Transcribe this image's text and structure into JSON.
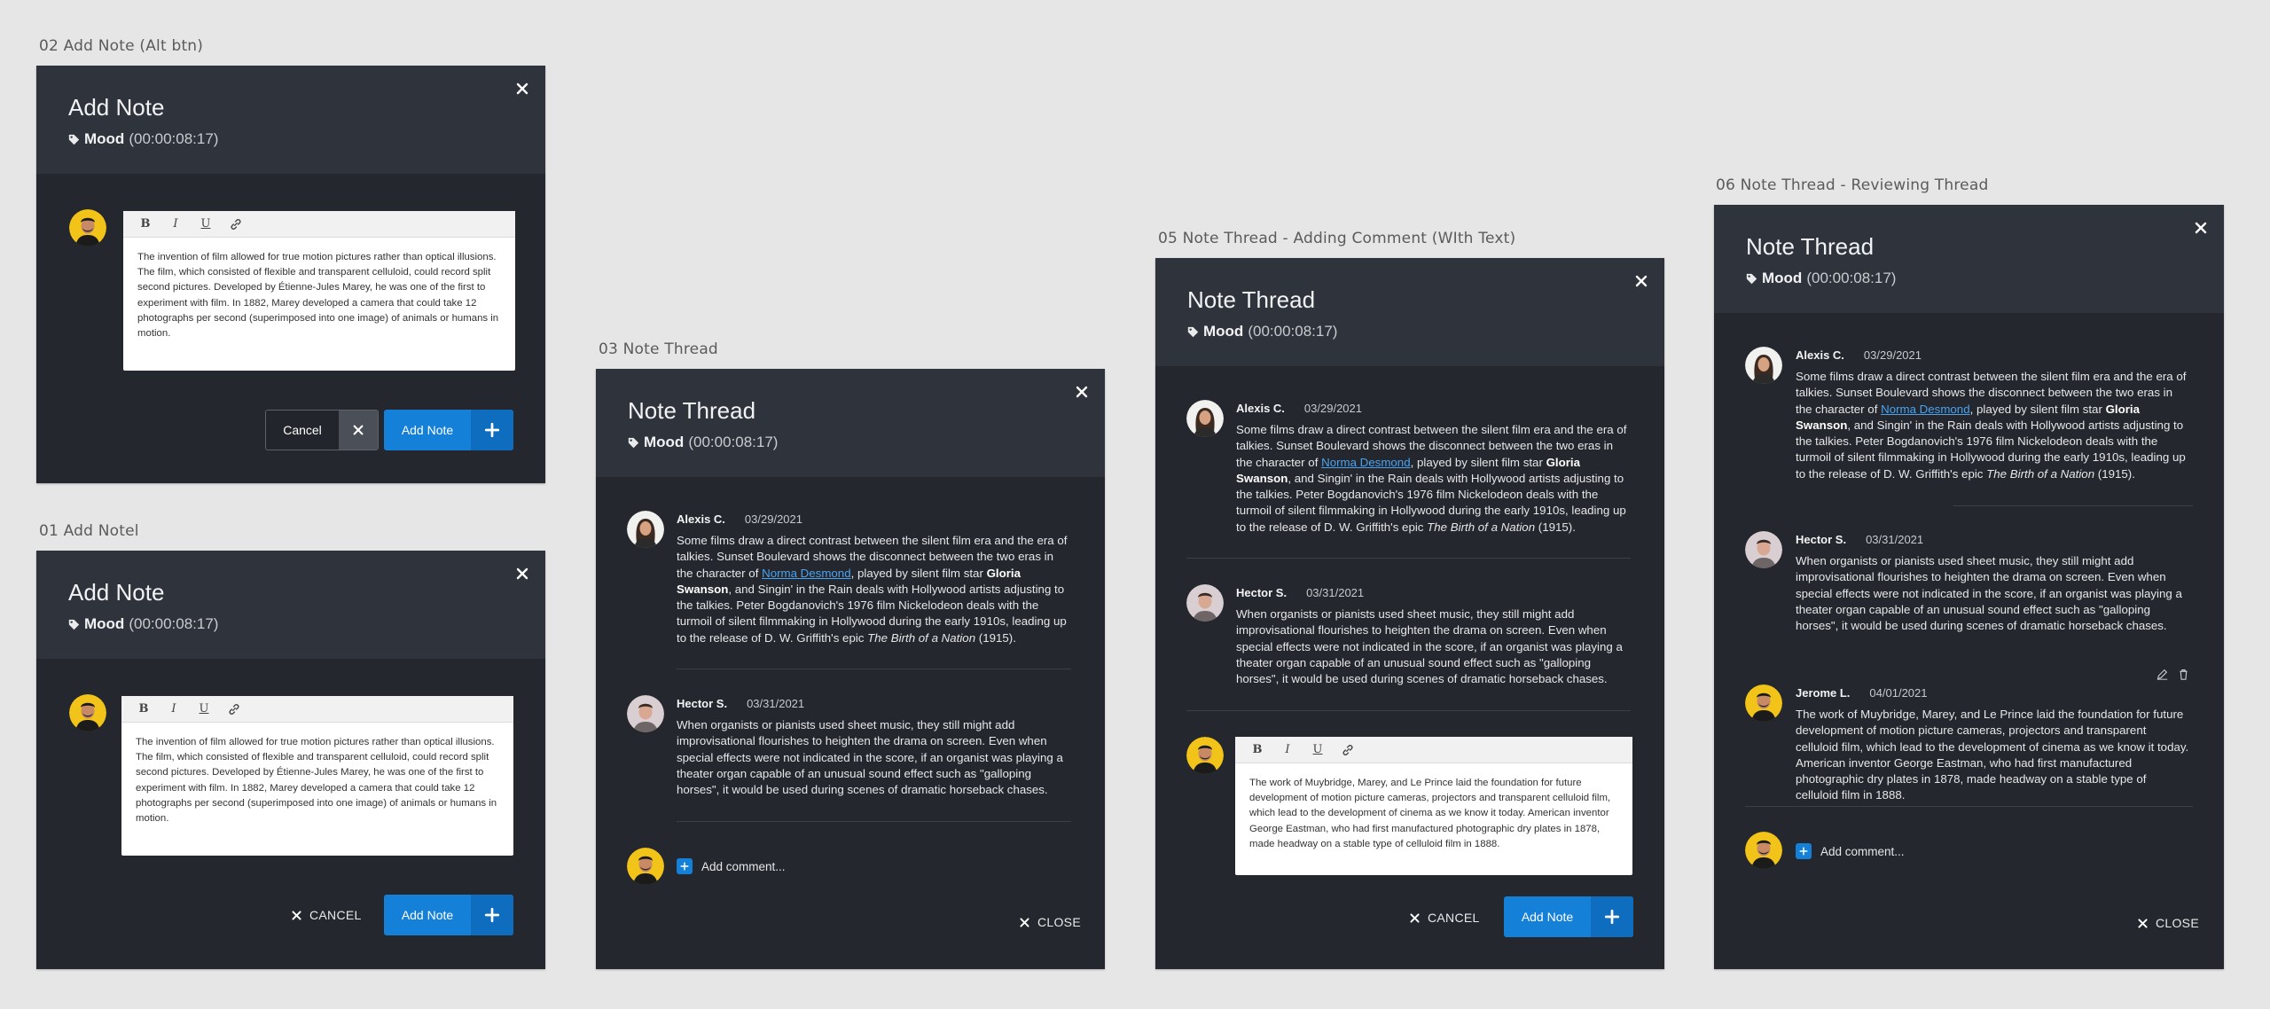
{
  "common": {
    "tag_name": "Mood",
    "tag_time": "(00:00:08:17)",
    "add_note_label": "Add Note",
    "cancel_label": "Cancel",
    "cancel_caps": "CANCEL",
    "close_caps": "CLOSE",
    "add_comment_placeholder": "Add comment...",
    "toolbar": [
      "B",
      "I",
      "U",
      "link"
    ]
  },
  "labels": {
    "frame02": "02 Add Note (Alt btn)",
    "frame01": "01 Add Notel",
    "frame03": "03 Note Thread",
    "frame05": "05 Note Thread - Adding Comment (WIth Text)",
    "frame06": "06 Note Thread - Reviewing Thread"
  },
  "titles": {
    "add_note": "Add Note",
    "note_thread": "Note Thread"
  },
  "draft_note": "The invention of film allowed for true motion pictures rather than optical illusions. The film, which consisted of flexible and transparent celluloid, could record split second pictures. Developed by Étienne-Jules Marey, he was one of the first to experiment with film. In 1882, Marey developed a camera that could take 12 photographs per second (superimposed into one image) of animals or humans in motion.",
  "draft_comment": "The work of Muybridge, Marey, and Le Prince laid the foundation for future development of motion picture cameras, projectors and transparent celluloid film, which lead to the development of cinema as we know it today. American inventor George Eastman, who had first manufactured photographic dry plates in 1878, made headway on a stable type of celluloid film in 1888.",
  "comments": {
    "alexis": {
      "author": "Alexis C.",
      "date": "03/29/2021",
      "text_a": "Some films draw a direct contrast between the silent film era and the era of talkies. Sunset Boulevard shows the disconnect between the two eras in the character of ",
      "link": "Norma Desmond",
      "text_b": ", played by silent film star ",
      "bold": "Gloria Swanson",
      "text_c": ", and Singin' in the Rain deals with Hollywood artists adjusting to the talkies. Peter Bogdanovich's 1976 film Nickelodeon deals with the turmoil of silent filmmaking in Hollywood during the early 1910s, leading up to the release of D. W. Griffith's epic ",
      "italic": "The Birth of a Nation",
      "text_d": " (1915)."
    },
    "hector": {
      "author": "Hector S.",
      "date": "03/31/2021",
      "text": "When organists or pianists used sheet music, they still might add improvisational flourishes to heighten the drama on screen. Even when special effects were not indicated in the score, if an organist was playing a theater organ capable of an unusual sound effect such as \"galloping horses\", it would be used during scenes of dramatic horseback chases."
    },
    "jerome": {
      "author": "Jerome L.",
      "date": "04/01/2021",
      "text": "The work of Muybridge, Marey, and Le Prince laid the foundation for future development of motion picture cameras, projectors and transparent celluloid film, which lead to the development of cinema as we know it today. American inventor George Eastman, who had first manufactured photographic dry plates in 1878, made headway on a stable type of celluloid film in 1888."
    }
  },
  "colors": {
    "accent": "#1580d8",
    "panel": "#24272d",
    "header": "#2f333b",
    "canvas": "#e6e6e6"
  }
}
